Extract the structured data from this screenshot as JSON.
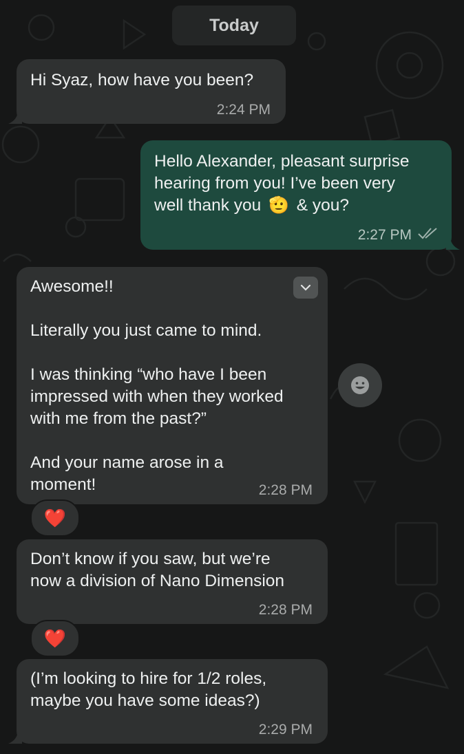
{
  "date_separator": "Today",
  "messages": [
    {
      "text": "Hi Syaz, how have you been?",
      "time": "2:24 PM",
      "direction": "incoming"
    },
    {
      "text": "Hello Alexander, pleasant surprise\nhearing from you! I’ve been very\nwell thank you",
      "text_after_emoji": "& you?",
      "emoji": "🫡",
      "time": "2:27 PM",
      "direction": "outgoing",
      "status": "read"
    },
    {
      "text": "Awesome!!\n\nLiterally you just came to mind.\n\nI was thinking “who have I been\nimpressed with when they worked\nwith me from the past?”\n\nAnd your name arose in a\nmoment!",
      "time": "2:28 PM",
      "direction": "incoming",
      "reaction": "❤️"
    },
    {
      "text": "Don’t know if you saw, but we’re\nnow a division of Nano Dimension",
      "time": "2:28 PM",
      "direction": "incoming",
      "reaction": "❤️"
    },
    {
      "text": "(I’m looking to hire for 1/2 roles,\nmaybe you have some ideas?)",
      "time": "2:29 PM",
      "direction": "incoming"
    }
  ],
  "colors": {
    "background": "#161717",
    "incoming_bubble": "#2f3131",
    "outgoing_bubble": "#1e4a3e",
    "read_ticks": "#9fb2ac"
  },
  "icons": {
    "message_menu": "chevron-down-icon",
    "add_reaction": "smiley-icon",
    "read_receipt": "double-check-icon"
  }
}
